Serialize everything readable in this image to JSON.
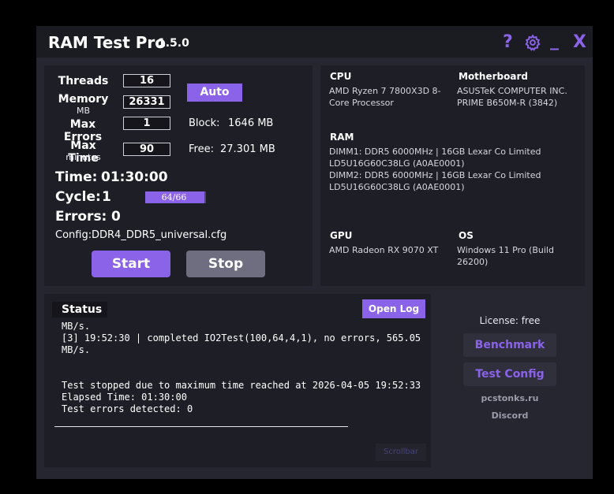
{
  "titlebar": {
    "app_name": "RAM Test Pro",
    "version": "1.5.0",
    "icons": {
      "help": "?",
      "settings": "gear-icon",
      "minimize": "_",
      "close": "X"
    }
  },
  "config": {
    "threads_label": "Threads",
    "threads_value": "16",
    "memory_label": "Memory",
    "memory_unit": "MB",
    "memory_value": "26331",
    "max_errors_label": "Max Errors",
    "max_errors_value": "1",
    "max_time_label": "Max Time",
    "max_time_unit": "minutes",
    "max_time_value": "90",
    "auto_label": "Auto",
    "block_label": "Block:",
    "block_value": "1646 MB",
    "free_label": "Free:",
    "free_value": "27.301 MB"
  },
  "progress": {
    "time_label": "Time:",
    "time_value": "01:30:00",
    "cycle_label": "Cycle:",
    "cycle_value": "1",
    "cycle_progress_text": "64/66",
    "cycle_progress_fraction": 0.97,
    "errors_label": "Errors:",
    "errors_value": "0",
    "config_label": "Config:",
    "config_value": "DDR4_DDR5_universal.cfg"
  },
  "actions": {
    "start_label": "Start",
    "stop_label": "Stop"
  },
  "system": {
    "cpu_header": "CPU",
    "cpu_line1": "AMD Ryzen 7 7800X3D 8-",
    "cpu_line2": "Core Processor",
    "mb_header": "Motherboard",
    "mb_line1": "ASUSTeK COMPUTER INC.",
    "mb_line2": "PRIME B650M-R (3842)",
    "ram_header": "RAM",
    "ram_line1": "DIMM1: DDR5 6000MHz | 16GB Lexar Co Limited",
    "ram_line2": "LD5U16G60C38LG (A0AE0001)",
    "ram_line3": "DIMM2: DDR5 6000MHz | 16GB Lexar Co Limited",
    "ram_line4": "LD5U16G60C38LG (A0AE0001)",
    "gpu_header": "GPU",
    "gpu_line1": "AMD Radeon RX 9070 XT",
    "os_header": "OS",
    "os_line1": "Windows 11 Pro (Build",
    "os_line2": "26200)"
  },
  "status": {
    "title": "Status",
    "open_log_label": "Open Log",
    "log_lines": [
      "MB/s.",
      "[3] 19:52:30 | completed IO2Test(100,64,4,1), no errors, 565.05",
      "MB/s.",
      "",
      "",
      "Test stopped due to maximum time reached at 2026-04-05 19:52:33",
      "Elapsed Time: 01:30:00",
      "Test errors detected: 0"
    ],
    "scrollbar_label": "Scrollbar"
  },
  "sidebar": {
    "license_text": "License: free",
    "benchmark_label": "Benchmark",
    "test_config_label": "Test Config",
    "site_link": "pcstonks.ru",
    "discord_link": "Discord"
  },
  "colors": {
    "accent": "#8a63e8",
    "window_bg": "#262630",
    "panel_bg": "#1e1e26"
  }
}
